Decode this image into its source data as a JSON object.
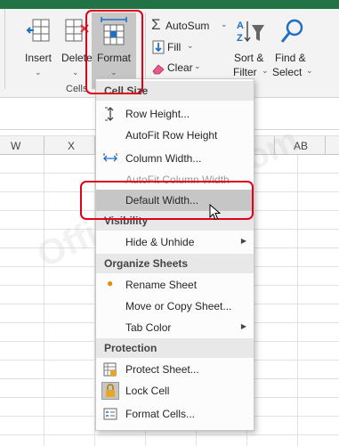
{
  "ribbon": {
    "insert_label": "Insert",
    "delete_label": "Delete",
    "format_label": "Format",
    "cells_group": "Cells",
    "autosum_label": "AutoSum",
    "fill_label": "Fill",
    "clear_label": "Clear",
    "sort_filter_line1": "Sort &",
    "sort_filter_line2": "Filter",
    "find_select_line1": "Find &",
    "find_select_line2": "Select",
    "dropdown_glyph": "⌄"
  },
  "columns": [
    "W",
    "X",
    "AB"
  ],
  "watermark": "OfficeDemo.com",
  "menu": {
    "cell_size_header": "Cell Size",
    "row_height": "Row Height...",
    "autofit_row_height": "AutoFit Row Height",
    "column_width": "Column Width...",
    "autofit_column_width": "AutoFit Column Width",
    "default_width": "Default Width...",
    "visibility_header": "Visibility",
    "hide_unhide": "Hide & Unhide",
    "organize_sheets_header": "Organize Sheets",
    "rename_sheet": "Rename Sheet",
    "move_copy_sheet": "Move or Copy Sheet...",
    "tab_color": "Tab Color",
    "protection_header": "Protection",
    "protect_sheet": "Protect Sheet...",
    "lock_cell": "Lock Cell",
    "format_cells": "Format Cells..."
  },
  "colors": {
    "highlight_box": "#e0001a",
    "accent_blue": "#1e6fc2",
    "excel_green": "#217346",
    "menu_header_bg": "#e8e8e8",
    "selected_item_bg": "#c6c6c6"
  }
}
